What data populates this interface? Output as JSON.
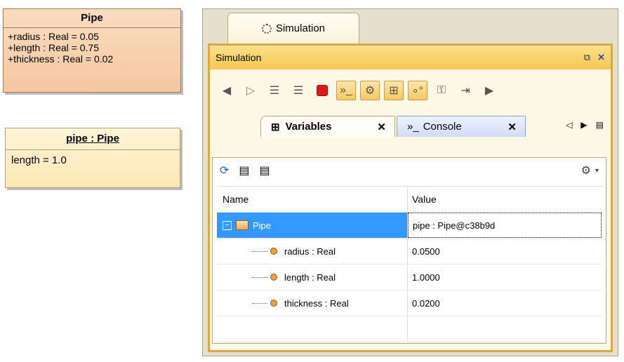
{
  "class_box": {
    "name": "Pipe",
    "attributes": [
      "+radius : Real = 0.05",
      "+length : Real = 0.75",
      "+thickness : Real = 0.02"
    ]
  },
  "instance_box": {
    "name": "pipe : Pipe",
    "slot": "length = 1.0"
  },
  "window": {
    "tab_label": "Simulation",
    "panel_title": "Simulation"
  },
  "tabs": {
    "variables": "Variables",
    "console": "Console"
  },
  "table": {
    "columns": [
      "Name",
      "Value"
    ],
    "root": {
      "name": "Pipe",
      "value": "pipe : Pipe@c38b9d"
    },
    "children": [
      {
        "name": "radius : Real",
        "value": "0.0500"
      },
      {
        "name": "length : Real",
        "value": "1.0000"
      },
      {
        "name": "thickness : Real",
        "value": "0.0200"
      }
    ]
  },
  "icons": {
    "play": "play-icon",
    "stop": "stop-icon",
    "gear": "gear-icon",
    "refresh": "refresh-icon"
  },
  "colors": {
    "header": "#f6c850",
    "selection": "#3399ff",
    "stop": "#e01818"
  }
}
